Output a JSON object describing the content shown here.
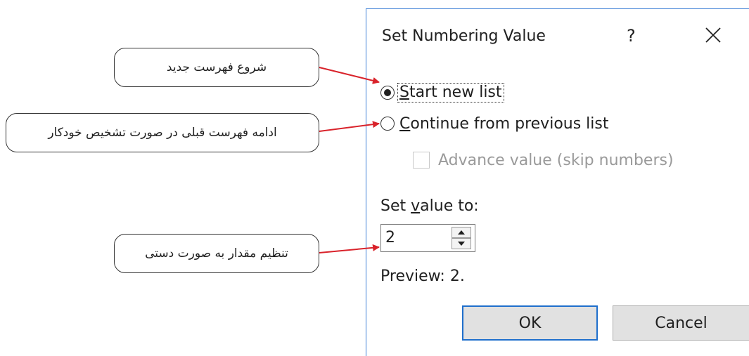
{
  "dialog": {
    "title": "Set Numbering Value",
    "help_label": "?",
    "options": {
      "start_new_list": {
        "pre": "",
        "mnemonic": "S",
        "rest": "tart new list",
        "checked": true
      },
      "continue_previous": {
        "pre": "",
        "mnemonic": "C",
        "rest": "ontinue from previous list",
        "checked": false
      }
    },
    "advance_value_label": "Advance value (skip numbers)",
    "set_value_label": {
      "pre": "Set ",
      "mnemonic": "v",
      "rest": "alue to:"
    },
    "value": "2",
    "preview": "Preview: 2.",
    "ok_label": "OK",
    "cancel_label": "Cancel",
    "icons": [
      "close-icon",
      "spin-up-icon",
      "spin-down-icon"
    ]
  },
  "annotations": {
    "start_new": "شروع فهرست جدید",
    "continue_previous": "ادامه فهرست قبلی در صورت تشخیص خودکار",
    "set_value": "تنظیم مقدار به صورت دستی"
  },
  "colors": {
    "accent": "#1f6fcc",
    "arrow": "#d9232b",
    "disabled_text": "#9a9a9a"
  }
}
